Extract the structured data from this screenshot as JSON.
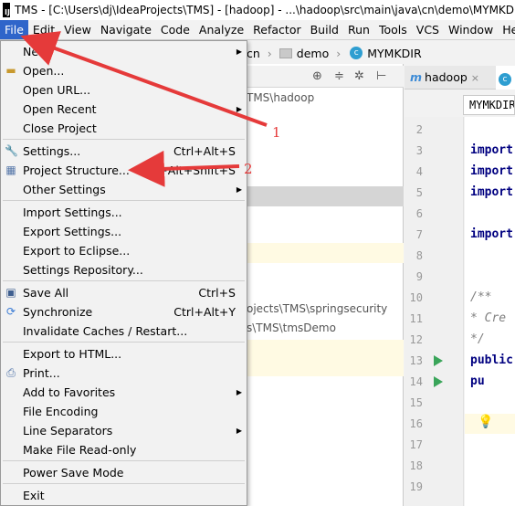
{
  "window": {
    "title": "TMS - [C:\\Users\\dj\\IdeaProjects\\TMS] - [hadoop] - ...\\hadoop\\src\\main\\java\\cn\\demo\\MYMKDIR.java"
  },
  "menubar": [
    "File",
    "Edit",
    "View",
    "Navigate",
    "Code",
    "Analyze",
    "Refactor",
    "Build",
    "Run",
    "Tools",
    "VCS",
    "Window",
    "Help"
  ],
  "navbar": {
    "seg1": "cn",
    "seg2": "demo",
    "seg3": "MYMKDIR"
  },
  "project": {
    "path_hadoop": "TMS\\hadoop",
    "path_springsecurity": "ojects\\TMS\\springsecurity",
    "path_tmsdemo": "s\\TMS\\tmsDemo"
  },
  "editor": {
    "tab1": "hadoop",
    "tab1_prefix": "m",
    "tab2_prefix": "c",
    "crumb": "MYMKDIR",
    "line_numbers": [
      "2",
      "3",
      "4",
      "5",
      "6",
      "7",
      "8",
      "9",
      "10",
      "11",
      "12",
      "13",
      "14",
      "15",
      "16",
      "17",
      "18",
      "19"
    ],
    "code": {
      "l3": "import",
      "l4": "import",
      "l5": "import",
      "l7": "import",
      "l10": "/**",
      "l11": " * Cre",
      "l12": " */",
      "l13": "public",
      "l14": "    pu"
    }
  },
  "file_menu": {
    "new": "New",
    "open": "Open...",
    "open_url": "Open URL...",
    "open_recent": "Open Recent",
    "close_project": "Close Project",
    "settings": "Settings...",
    "settings_sc": "Ctrl+Alt+S",
    "project_structure": "Project Structure...",
    "project_structure_sc": "Ctrl+Alt+Shift+S",
    "other_settings": "Other Settings",
    "import_settings": "Import Settings...",
    "export_settings": "Export Settings...",
    "export_eclipse": "Export to Eclipse...",
    "settings_repo": "Settings Repository...",
    "save_all": "Save All",
    "save_all_sc": "Ctrl+S",
    "synchronize": "Synchronize",
    "synchronize_sc": "Ctrl+Alt+Y",
    "invalidate": "Invalidate Caches / Restart...",
    "export_html": "Export to HTML...",
    "print": "Print...",
    "favorites": "Add to Favorites",
    "encoding": "File Encoding",
    "line_sep": "Line Separators",
    "read_only": "Make File Read-only",
    "power_save": "Power Save Mode",
    "exit": "Exit"
  },
  "annotations": {
    "n1": "1",
    "n2": "2"
  },
  "colors": {
    "accent": "#2f65ca",
    "arrow": "#e53a3a",
    "run": "#3aa55a"
  }
}
